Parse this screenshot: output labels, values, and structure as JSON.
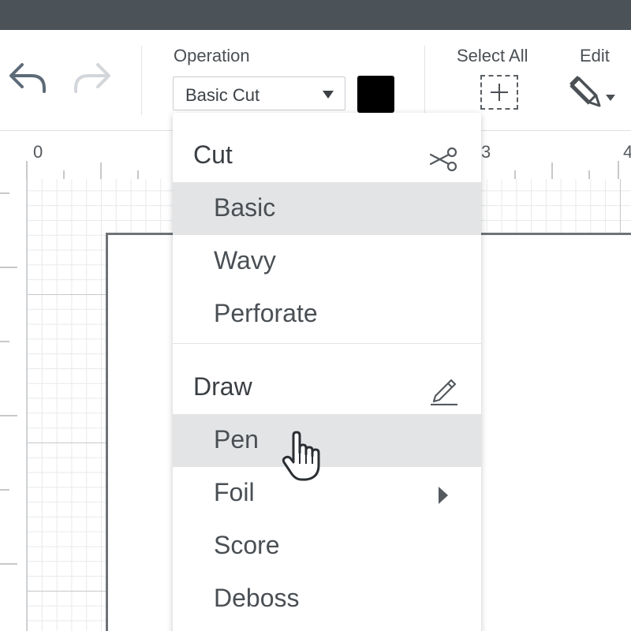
{
  "toolbar": {
    "operation_label": "Operation",
    "operation_value": "Basic Cut",
    "color_swatch": "#000000",
    "select_all_label": "Select All",
    "edit_label": "Edit",
    "undo_icon": "undo-icon",
    "redo_icon": "redo-icon",
    "select_all_icon": "select-all-icon",
    "edit_icon": "edit-tools-icon"
  },
  "ruler": {
    "labels": [
      "0",
      "3",
      "4"
    ]
  },
  "operation_menu": {
    "cut_group": {
      "heading": "Cut",
      "icon": "scissors-icon",
      "items": [
        "Basic",
        "Wavy",
        "Perforate"
      ]
    },
    "draw_group": {
      "heading": "Draw",
      "icon": "pen-icon",
      "items": [
        "Pen",
        "Foil",
        "Score",
        "Deboss"
      ]
    },
    "selected_items": [
      "Basic",
      "Pen"
    ],
    "submenu_item": "Foil"
  },
  "colors": {
    "top_bar": "#4b5358",
    "selection_highlight": "#e3e4e6"
  }
}
